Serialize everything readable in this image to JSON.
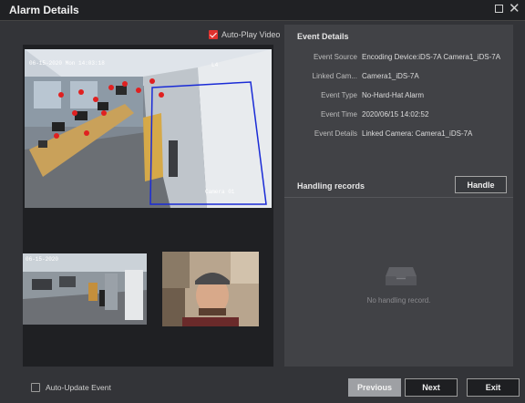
{
  "window": {
    "title": "Alarm Details"
  },
  "autoplay": {
    "label": "Auto-Play Video",
    "checked": true
  },
  "video": {
    "main_timestamp": "06-15-2020 Mon 14:03:18",
    "main_osd_top_right": "L4",
    "main_osd_camera": "Camera 01",
    "thumb1_timestamp": "06-15-2020"
  },
  "event_details": {
    "header": "Event Details",
    "rows": [
      {
        "label": "Event Source",
        "value": "Encoding Device:iDS-7A Camera1_iDS-7A"
      },
      {
        "label": "Linked Cam...",
        "value": "Camera1_iDS-7A"
      },
      {
        "label": "Event Type",
        "value": "No-Hard-Hat Alarm"
      },
      {
        "label": "Event Time",
        "value": "2020/06/15 14:02:52"
      },
      {
        "label": "Event Details",
        "value": "Linked Camera: Camera1_iDS-7A"
      }
    ]
  },
  "handling": {
    "title": "Handling records",
    "handle_label": "Handle",
    "empty_text": "No handling record."
  },
  "footer": {
    "autoupdate_label": "Auto-Update Event",
    "autoupdate_checked": false,
    "previous_label": "Previous",
    "next_label": "Next",
    "exit_label": "Exit"
  },
  "icons": [
    "close-icon",
    "maximize-icon",
    "checkbox-checked-icon",
    "checkbox-unchecked-icon",
    "empty-tray-icon"
  ],
  "colors": {
    "accent": "#e0322e",
    "detection_box": "#1a2bd6"
  }
}
